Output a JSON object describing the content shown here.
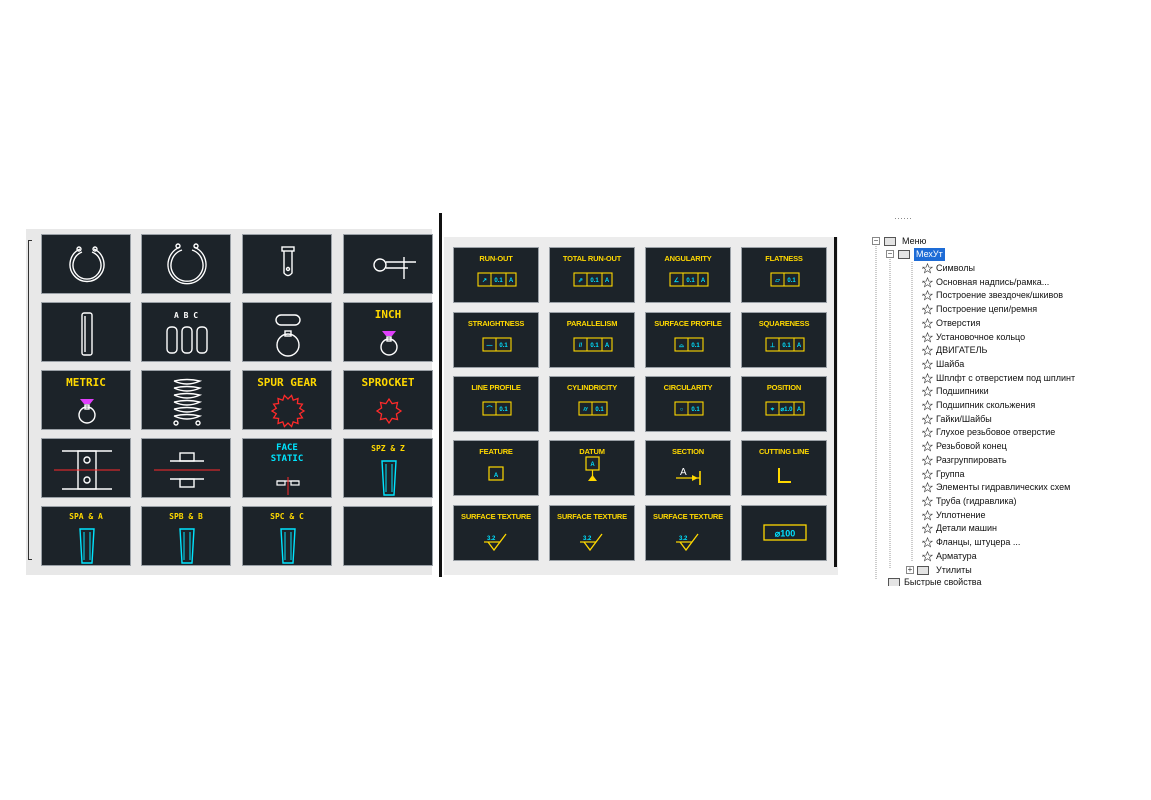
{
  "left_palette": {
    "tiles": [
      {
        "label": "",
        "icon": "circlip-external-icon"
      },
      {
        "label": "",
        "icon": "circlip-internal-icon"
      },
      {
        "label": "",
        "icon": "pin-icon"
      },
      {
        "label": "",
        "icon": "split-pin-icon"
      },
      {
        "label": "",
        "icon": "key-icon"
      },
      {
        "label": "A  B  C",
        "icon": "keys-abc-icon"
      },
      {
        "label": "",
        "icon": "shaft-key-icon"
      },
      {
        "label": "INCH",
        "icon": "shaft-inch-icon"
      },
      {
        "label": "METRIC",
        "icon": "shaft-metric-icon"
      },
      {
        "label": "",
        "icon": "spring-icon"
      },
      {
        "label": "SPUR GEAR",
        "icon": "spur-gear-icon"
      },
      {
        "label": "SPROCKET",
        "icon": "sprocket-icon"
      },
      {
        "label": "",
        "icon": "bearing-section-icon"
      },
      {
        "label": "",
        "icon": "bearing-side-icon"
      },
      {
        "label": "FACE\nSTATIC",
        "icon": "face-seal-icon"
      },
      {
        "label": "SPZ & Z",
        "icon": "belt-spz-icon"
      },
      {
        "label": "SPA & A",
        "icon": "belt-spa-icon"
      },
      {
        "label": "SPB & B",
        "icon": "belt-spb-icon"
      },
      {
        "label": "SPC & C",
        "icon": "belt-spc-icon"
      },
      {
        "label": "",
        "icon": "empty-tile"
      }
    ],
    "colors": {
      "tile_bg": "#1c2329",
      "white": "#ffffff",
      "yellow": "#ffd800",
      "cyan": "#00e5ff",
      "red": "#ff2a2a",
      "magenta": "#e040fb"
    }
  },
  "gdt_palette": {
    "tiles": [
      {
        "label": "RUN-OUT",
        "frame": [
          "↗",
          "0.1",
          "A"
        ],
        "icon": "runout-icon"
      },
      {
        "label": "TOTAL RUN-OUT",
        "frame": [
          "⇗",
          "0.1",
          "A"
        ],
        "icon": "total-runout-icon"
      },
      {
        "label": "ANGULARITY",
        "frame": [
          "∠",
          "0.1",
          "A"
        ],
        "icon": "angularity-icon"
      },
      {
        "label": "FLATNESS",
        "frame": [
          "▱",
          "0.1"
        ],
        "icon": "flatness-icon"
      },
      {
        "label": "STRAIGHTNESS",
        "frame": [
          "—",
          "0.1"
        ],
        "icon": "straightness-icon"
      },
      {
        "label": "PARALLELISM",
        "frame": [
          "//",
          "0.1",
          "A"
        ],
        "icon": "parallelism-icon"
      },
      {
        "label": "SURFACE PROFILE",
        "frame": [
          "⌓",
          "0.1"
        ],
        "icon": "surface-profile-icon"
      },
      {
        "label": "SQUARENESS",
        "frame": [
          "⊥",
          "0.1",
          "A"
        ],
        "icon": "squareness-icon"
      },
      {
        "label": "LINE PROFILE",
        "frame": [
          "⌒",
          "0.1"
        ],
        "icon": "line-profile-icon"
      },
      {
        "label": "CYLINDRICITY",
        "frame": [
          "⌭",
          "0.1"
        ],
        "icon": "cylindricity-icon"
      },
      {
        "label": "CIRCULARITY",
        "frame": [
          "○",
          "0.1"
        ],
        "icon": "circularity-icon"
      },
      {
        "label": "POSITION",
        "frame": [
          "⌖",
          "⌀1.0",
          "A"
        ],
        "icon": "position-icon"
      },
      {
        "label": "FEATURE",
        "frame": [
          "A"
        ],
        "icon": "feature-icon"
      },
      {
        "label": "DATUM",
        "frame": [
          "A"
        ],
        "icon": "datum-icon"
      },
      {
        "label": "SECTION",
        "frame": [
          "A"
        ],
        "icon": "section-icon"
      },
      {
        "label": "CUTTING LINE",
        "frame": [],
        "icon": "cutting-line-icon"
      },
      {
        "label": "SURFACE TEXTURE",
        "frame": [
          "3.2"
        ],
        "icon": "surface-texture-icon"
      },
      {
        "label": "SURFACE TEXTURE",
        "frame": [
          "3.2"
        ],
        "icon": "surface-texture-icon"
      },
      {
        "label": "SURFACE TEXTURE",
        "frame": [
          "3.2"
        ],
        "icon": "surface-texture-icon"
      },
      {
        "label": "",
        "frame": [
          "⌀100"
        ],
        "icon": "diameter-icon"
      }
    ]
  },
  "tree": {
    "top_cut": "······",
    "root": {
      "label": "Меню"
    },
    "group": {
      "label": "МехУт"
    },
    "items": [
      "Символы",
      "Основная надпись/рамка...",
      "Построение звездочек/шкивов",
      "Построение цепи/ремня",
      "Отверстия",
      "Установочное кольцо",
      "ДВИГАТЕЛЬ",
      "Шайба",
      "Шплфт с отверстием под шплинт",
      "Подшипники",
      "Подшипник скольжения",
      "Гайки/Шайбы",
      "Глухое резьбовое отверстие",
      "Резьбовой конец",
      "Разгруппировать",
      "Группа",
      "Элементы гидравлических схем",
      "Труба (гидравлика)",
      "Уплотнение",
      "Детали машин",
      "Фланцы, штуцера ...",
      "Арматура"
    ],
    "utilities": {
      "label": "Утилиты"
    },
    "bottom": {
      "label": "Быстрые свойства"
    }
  }
}
